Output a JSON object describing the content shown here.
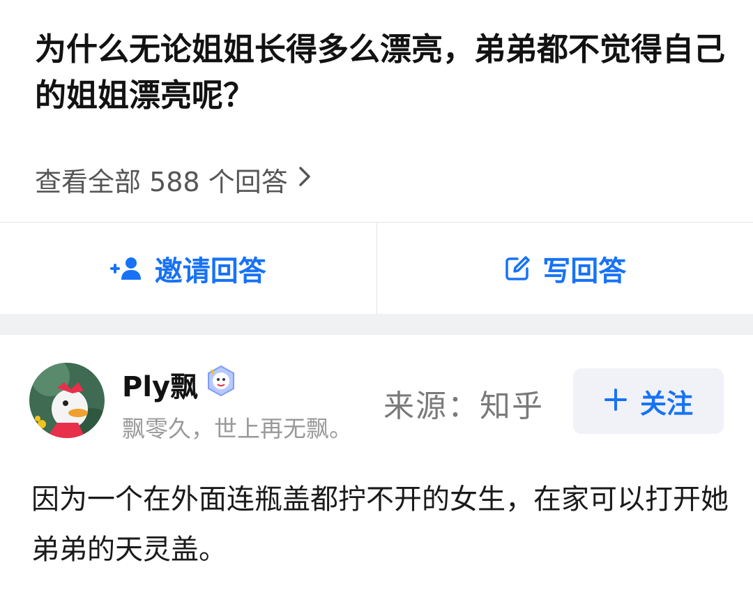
{
  "question": {
    "title": "为什么无论姐姐长得多么漂亮，弟弟都不觉得自己的姐姐漂亮呢？",
    "view_all_label": "查看全部 588 个回答"
  },
  "actions": {
    "invite_label": "邀请回答",
    "write_label": "写回答"
  },
  "answer": {
    "author_name": "Ply飘",
    "author_bio": "飘零久，世上再无飘。",
    "follow_label": "关注",
    "body": "因为一个在外面连瓶盖都拧不开的女生，在家可以打开她弟弟的天灵盖。"
  },
  "watermark": "来源：知乎",
  "icons": {
    "invite": "add-user-icon",
    "write": "edit-icon",
    "view_all": "chevron-right-icon",
    "follow": "plus-icon",
    "badge": "creator-badge-icon"
  },
  "colors": {
    "accent": "#1772f6",
    "secondary_text": "#999999",
    "divider": "#e4e4e4",
    "section_gap": "#f0f1f3"
  }
}
